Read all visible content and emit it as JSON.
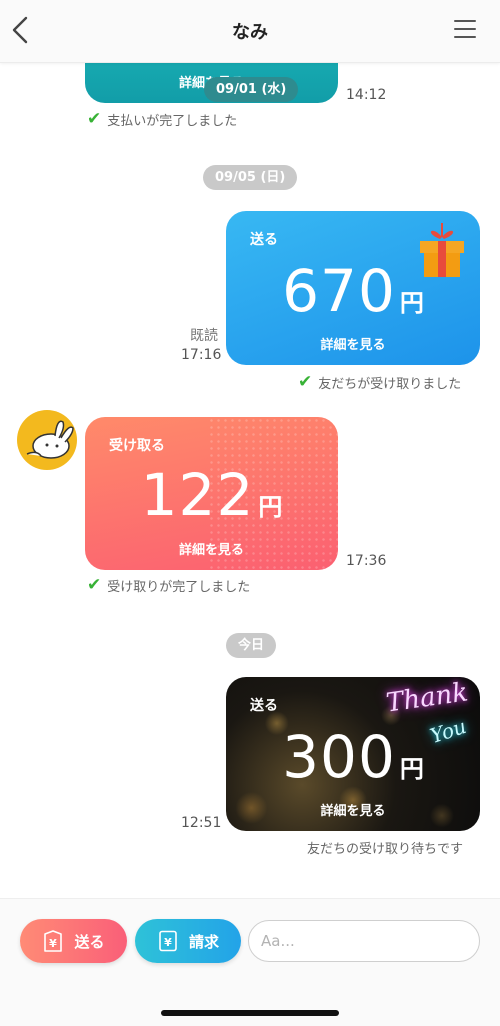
{
  "header": {
    "title": "なみ"
  },
  "messages": {
    "m1": {
      "detail_label": "詳細を見る",
      "date_overlay": "09/01 (水)",
      "time": "14:12",
      "status": "支払いが完了しました"
    },
    "date_chip_1": "09/05 (日)",
    "m2": {
      "type_label": "送る",
      "amount": "670",
      "currency": "円",
      "detail_label": "詳細を見る",
      "read_label": "既読",
      "time": "17:16",
      "status": "友だちが受け取りました"
    },
    "m3": {
      "type_label": "受け取る",
      "amount": "122",
      "currency": "円",
      "detail_label": "詳細を見る",
      "time": "17:36",
      "status": "受け取りが完了しました"
    },
    "date_chip_2": "今日",
    "m4": {
      "type_label": "送る",
      "amount": "300",
      "currency": "円",
      "detail_label": "詳細を見る",
      "time": "12:51",
      "status": "友だちの受け取り待ちです",
      "neon_line1": "Thank",
      "neon_line2": "You"
    }
  },
  "footer": {
    "send_button": "送る",
    "request_button": "請求",
    "input_placeholder": "Aa..."
  },
  "colors": {
    "send_card": "#2aa2ee",
    "receive_card": "#fc6a6f",
    "check": "#38b236",
    "date_chip": "#c9c9c9"
  }
}
